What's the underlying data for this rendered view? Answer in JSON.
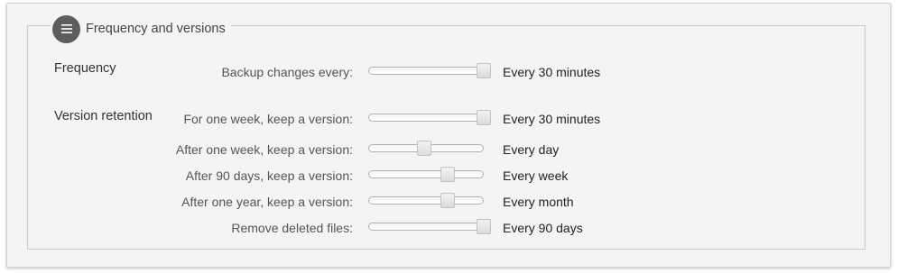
{
  "group": {
    "title": "Frequency and versions",
    "icon": "list-icon"
  },
  "frequency": {
    "section_label": "Frequency",
    "rows": [
      {
        "label": "Backup changes every:",
        "value": "Every 30 minutes",
        "level": 1.0
      }
    ]
  },
  "retention": {
    "section_label": "Version retention",
    "rows": [
      {
        "label": "For one week, keep a version:",
        "value": "Every 30 minutes",
        "level": 1.0
      },
      {
        "label": "After one week, keep a version:",
        "value": "Every day",
        "level": 0.45
      },
      {
        "label": "After 90 days, keep a version:",
        "value": "Every week",
        "level": 0.67
      },
      {
        "label": "After one year, keep a version:",
        "value": "Every month",
        "level": 0.67
      },
      {
        "label": "Remove deleted files:",
        "value": "Every 90 days",
        "level": 1.0
      }
    ]
  }
}
